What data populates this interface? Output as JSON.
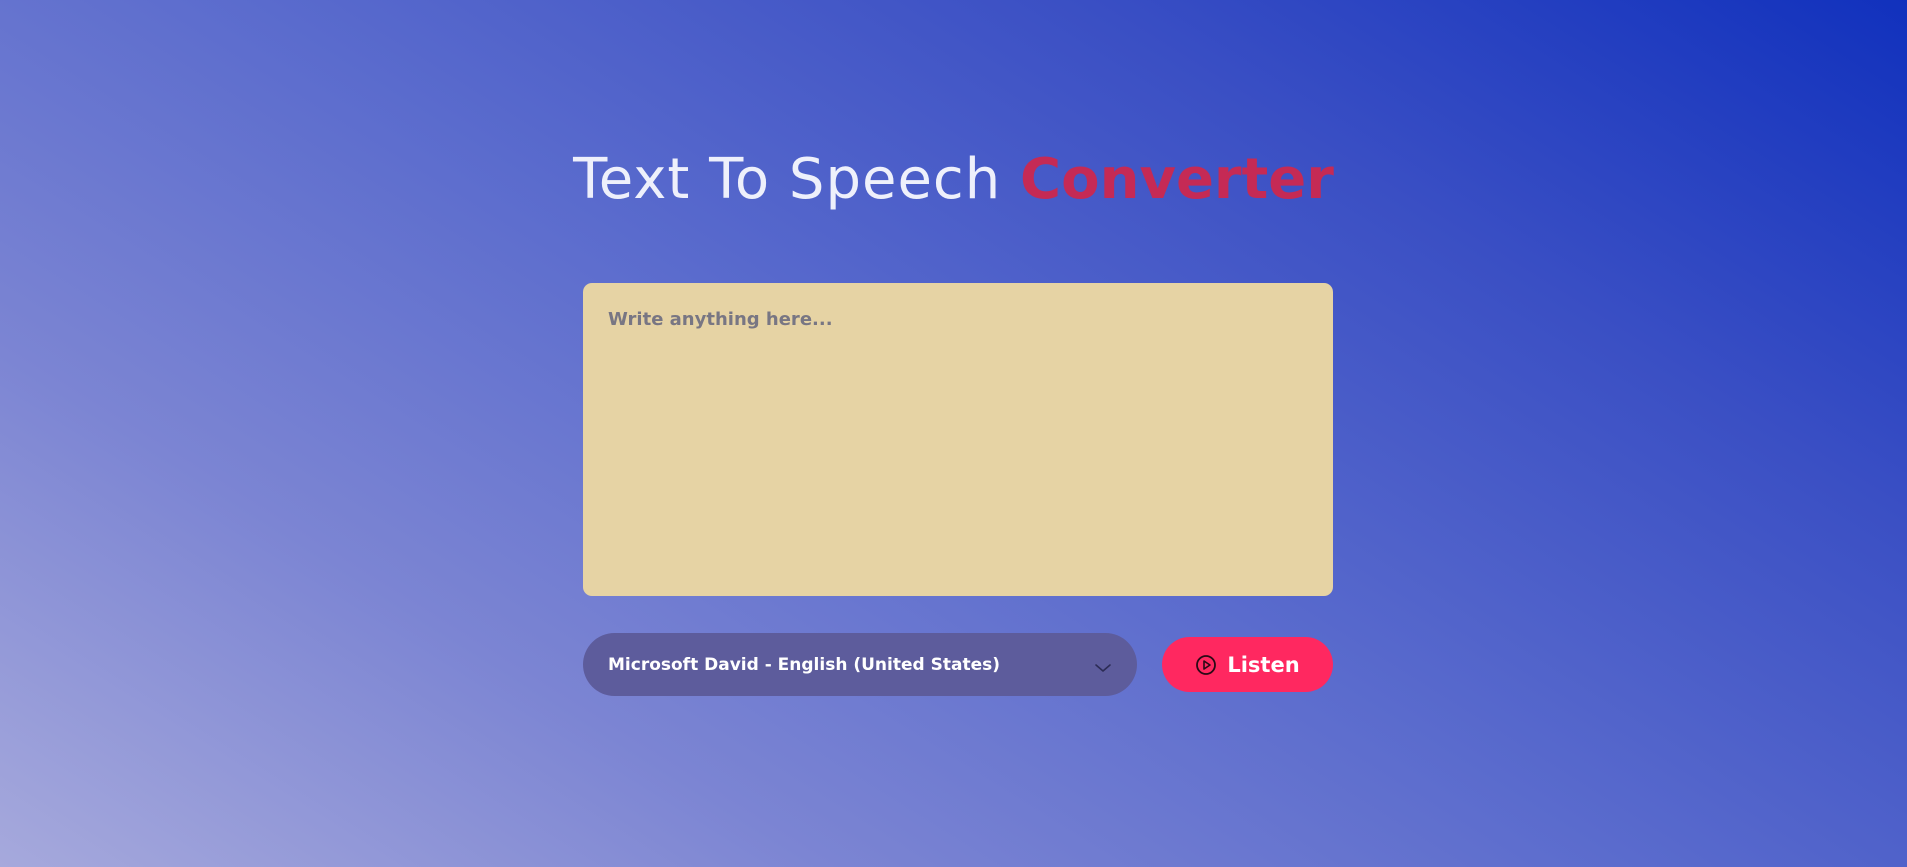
{
  "header": {
    "title_main": "Text To Speech ",
    "title_accent": "Converter"
  },
  "editor": {
    "placeholder": "Write anything here...",
    "value": ""
  },
  "voice_select": {
    "selected": "Microsoft David - English (United States)",
    "icon": "chevron-down-icon"
  },
  "listen_button": {
    "label": "Listen",
    "icon": "play-circle-icon"
  },
  "colors": {
    "accent": "#c52a55",
    "button": "#ff2860",
    "editor_bg": "#e6d3a4",
    "select_bg": "#5d5c9c"
  }
}
